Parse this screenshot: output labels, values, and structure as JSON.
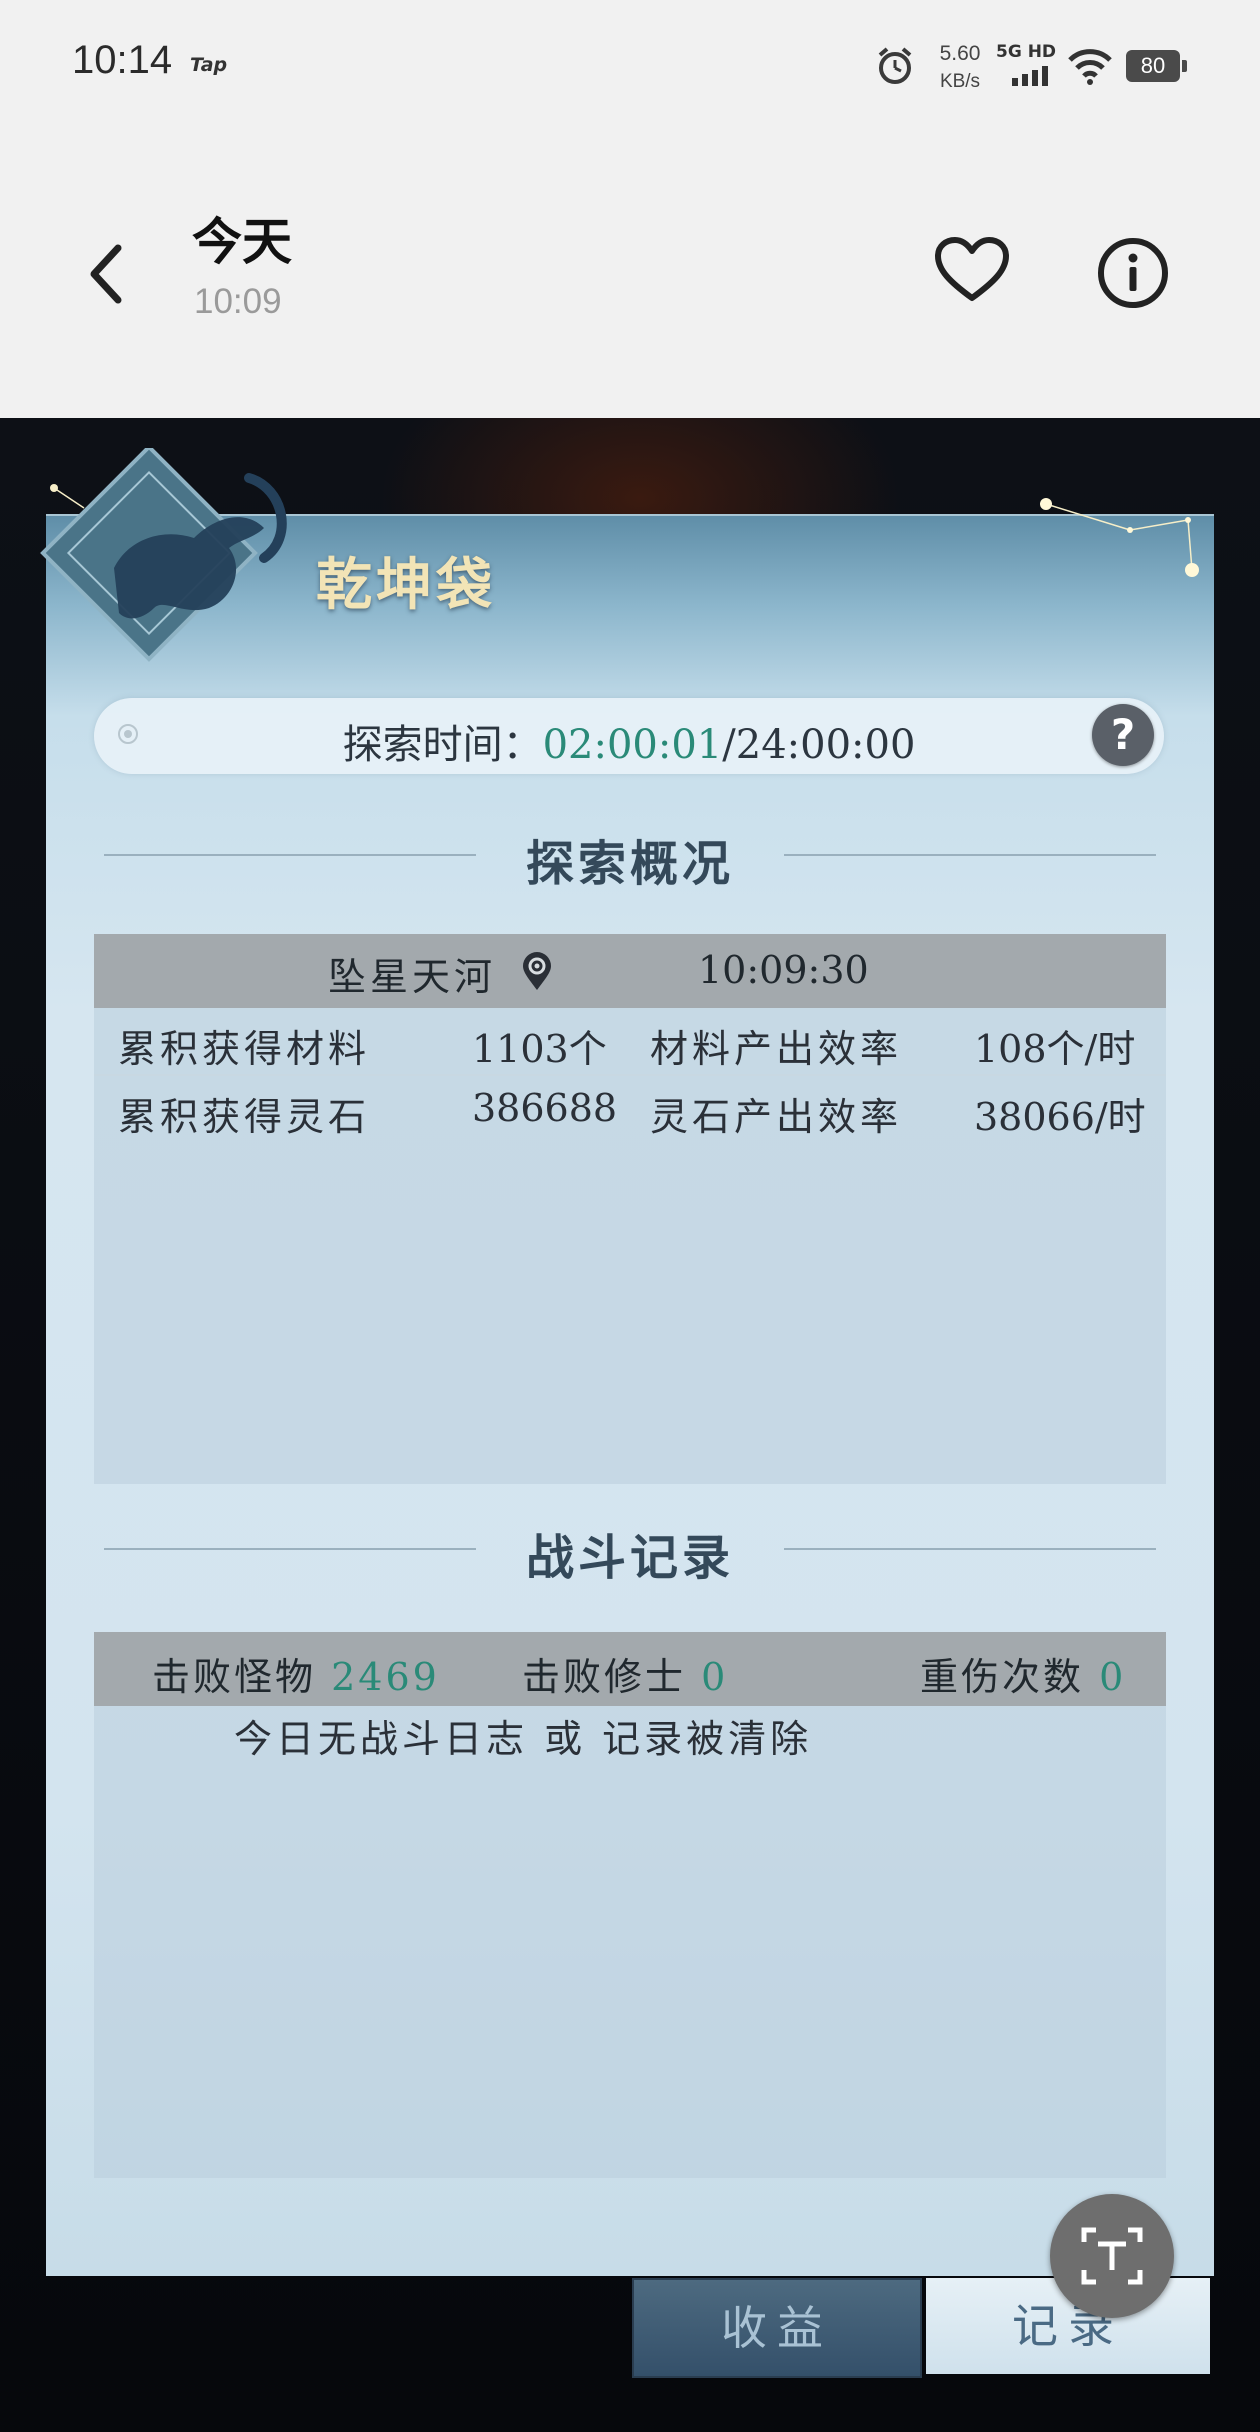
{
  "status_bar": {
    "time": "10:14",
    "tap_label": "Tap",
    "net_speed_value": "5.60",
    "net_speed_unit": "KB/s",
    "network": "5G HD",
    "battery": "80"
  },
  "header": {
    "title": "今天",
    "subtitle": "10:09"
  },
  "game": {
    "panel_title": "乾坤袋",
    "explore_label": "探索时间：",
    "explore_elapsed": "02:00:01",
    "explore_total": "/24:00:00",
    "help_label": "?",
    "overview": {
      "heading": "探索概况",
      "location": "坠星天河",
      "time": "10:09:30",
      "rows": [
        {
          "label": "累积获得材料",
          "value": "1103个",
          "rate_label": "材料产出效率",
          "rate_value": "108个/时"
        },
        {
          "label": "累积获得灵石",
          "value": "386688",
          "rate_label": "灵石产出效率",
          "rate_value": "38066/时"
        }
      ]
    },
    "battle": {
      "heading": "战斗记录",
      "monsters_label": "击败怪物",
      "monsters_value": "2469",
      "cultivators_label": "击败修士",
      "cultivators_value": "0",
      "injuries_label": "重伤次数",
      "injuries_value": "0",
      "empty_text": "今日无战斗日志 或 记录被清除"
    },
    "tabs": [
      {
        "label": "收益"
      },
      {
        "label": "记录"
      }
    ]
  },
  "colors": {
    "accent_teal": "#2a8a78",
    "accent_orange": "#d0841f",
    "title_gold": "#f2e4b6"
  },
  "icons": [
    "back-arrow-icon",
    "heart-icon",
    "info-icon",
    "alarm-icon",
    "signal-icon",
    "wifi-icon",
    "location-pin-icon",
    "help-icon",
    "text-scan-icon"
  ]
}
